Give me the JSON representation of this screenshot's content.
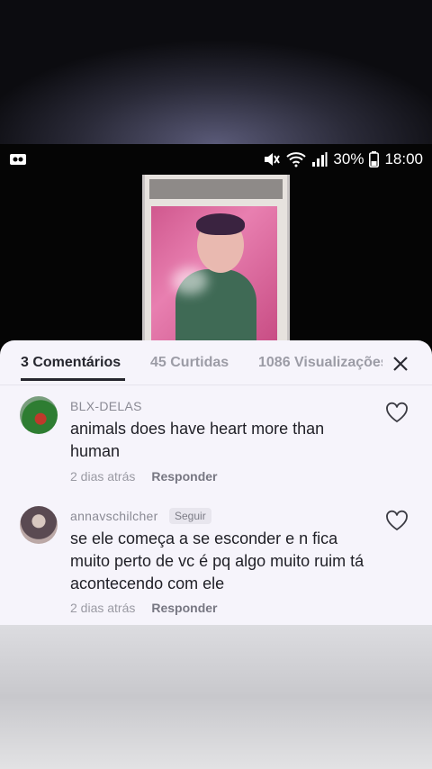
{
  "statusbar": {
    "battery_percent": "30%",
    "time": "18:00",
    "icons": [
      "screen-recorder-icon",
      "mute-vibrate-icon",
      "wifi-icon",
      "signal-icon",
      "battery-icon"
    ]
  },
  "tabs": {
    "comments": "3 Comentários",
    "shares": "45 Curtidas",
    "views": "1086 Visualizações"
  },
  "comments": [
    {
      "username": "BLX-DELAS",
      "text": "animals does have heart more than human",
      "time": "2 dias atrás",
      "reply_label": "Responder"
    },
    {
      "username": "annavschilcher",
      "follow_label": "Seguir",
      "text": "se ele começa a se esconder e n fica muito perto de vc é pq algo muito ruim tá acontecendo com ele",
      "time": "2 dias atrás",
      "reply_label": "Responder"
    }
  ]
}
